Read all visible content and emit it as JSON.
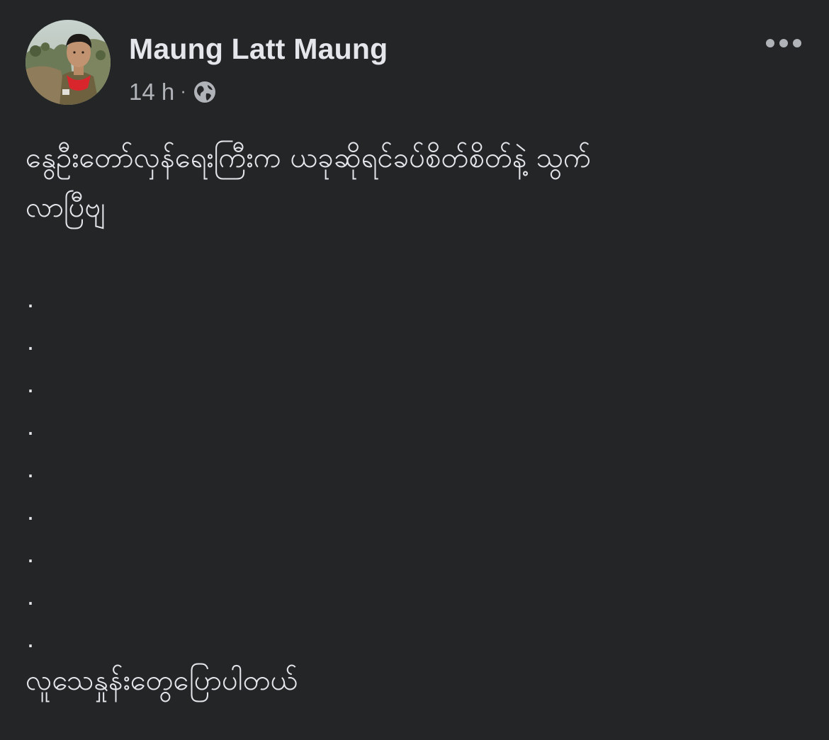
{
  "post": {
    "author": {
      "name": "Maung Latt Maung",
      "avatar_icon": "profile-photo-icon"
    },
    "meta": {
      "time": "14 h",
      "separator": "·",
      "privacy_icon": "globe-icon"
    },
    "more_icon": "more-options-icon",
    "text": {
      "line1": "နွေဦးတော်လှန်ရေးကြီးက ယခုဆိုရင်ခပ်စိတ်စိတ်နဲ့ သွက်",
      "line2": "လာပြီဗျ",
      "dots": [
        ".",
        ".",
        ".",
        ".",
        ".",
        ".",
        ".",
        ".",
        "."
      ],
      "last_line": "လူသေနှုန်းတွေပြောပါတယ်"
    }
  },
  "colors": {
    "background": "#242526",
    "primary_text": "#e4e6eb",
    "secondary_text": "#b0b3b8"
  }
}
